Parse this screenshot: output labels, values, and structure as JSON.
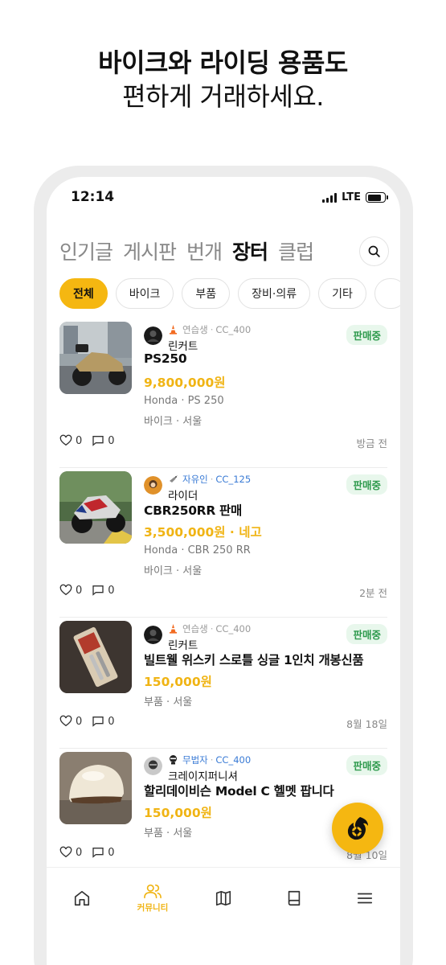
{
  "headline": {
    "line1": "바이크와 라이딩 용품도",
    "line2": "편하게 거래하세요."
  },
  "status_bar": {
    "time": "12:14",
    "network": "LTE"
  },
  "top_tabs": [
    {
      "label": "인기글",
      "active": false
    },
    {
      "label": "게시판",
      "active": false
    },
    {
      "label": "번개",
      "active": false
    },
    {
      "label": "장터",
      "active": true
    },
    {
      "label": "클럽",
      "active": false
    }
  ],
  "search_icon": "search-icon",
  "filter_chips": [
    {
      "label": "전체",
      "active": true
    },
    {
      "label": "바이크",
      "active": false
    },
    {
      "label": "부품",
      "active": false
    },
    {
      "label": "장비·의류",
      "active": false
    },
    {
      "label": "기타",
      "active": false
    }
  ],
  "listings": [
    {
      "level": "연습생",
      "license": "CC_400",
      "seller": "린커트",
      "status": "판매중",
      "title": "PS250",
      "price": "9,800,000원",
      "spec": "Honda · PS 250",
      "location": "바이크 · 서울",
      "likes": "0",
      "comments": "0",
      "time_ago": "방금 전"
    },
    {
      "level": "자유인",
      "license": "CC_125",
      "seller": "라이더",
      "status": "판매중",
      "title": "CBR250RR 판매",
      "price": "3,500,000원 · 네고",
      "spec": "Honda · CBR 250 RR",
      "location": "바이크 · 서울",
      "likes": "0",
      "comments": "0",
      "time_ago": "2분 전"
    },
    {
      "level": "연습생",
      "license": "CC_400",
      "seller": "린커트",
      "status": "판매중",
      "title": "빌트웰 위스키 스로틀 싱글 1인치 개봉신품",
      "price": "150,000원",
      "location": "부품 · 서울",
      "likes": "0",
      "comments": "0",
      "time_ago": "8월 18일"
    },
    {
      "level": "무법자",
      "license": "CC_400",
      "seller": "크레이지퍼니셔",
      "status": "판매중",
      "title": "할리데이비슨 Model C 헬멧 팝니다",
      "price": "150,000원",
      "location": "부품 · 서울",
      "likes": "0",
      "comments": "0",
      "time_ago": "8월 10일"
    }
  ],
  "bottom_nav": [
    {
      "icon": "home-icon",
      "label": ""
    },
    {
      "icon": "community-icon",
      "label": "커뮤니티",
      "active": true
    },
    {
      "icon": "map-icon",
      "label": ""
    },
    {
      "icon": "book-icon",
      "label": ""
    },
    {
      "icon": "menu-icon",
      "label": ""
    }
  ],
  "colors": {
    "accent": "#f5b711",
    "price": "#f0b414",
    "badge_bg": "#e8f7ec",
    "badge_text": "#2e9a4d",
    "level_blue": "#3a7bd5"
  }
}
